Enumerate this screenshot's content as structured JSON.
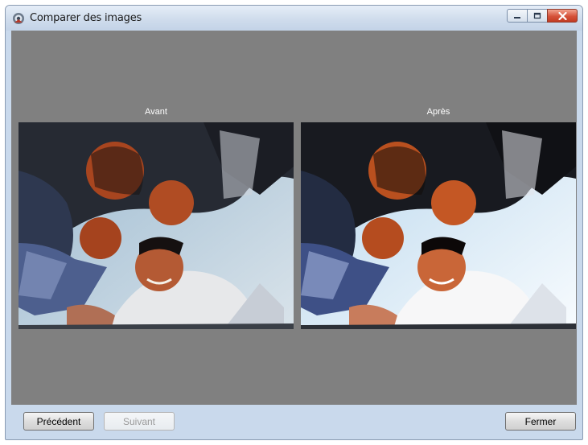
{
  "window": {
    "title": "Comparer des images",
    "controls": [
      "minimize-icon",
      "maximize-icon",
      "close-icon"
    ]
  },
  "panes": {
    "before_label": "Avant",
    "after_label": "Après"
  },
  "buttons": {
    "previous": "Précédent",
    "next": "Suivant",
    "close": "Fermer"
  },
  "colors": {
    "viewer_background": "#808080",
    "frame": "#c9d9ec",
    "close_button": "#c94a30"
  }
}
